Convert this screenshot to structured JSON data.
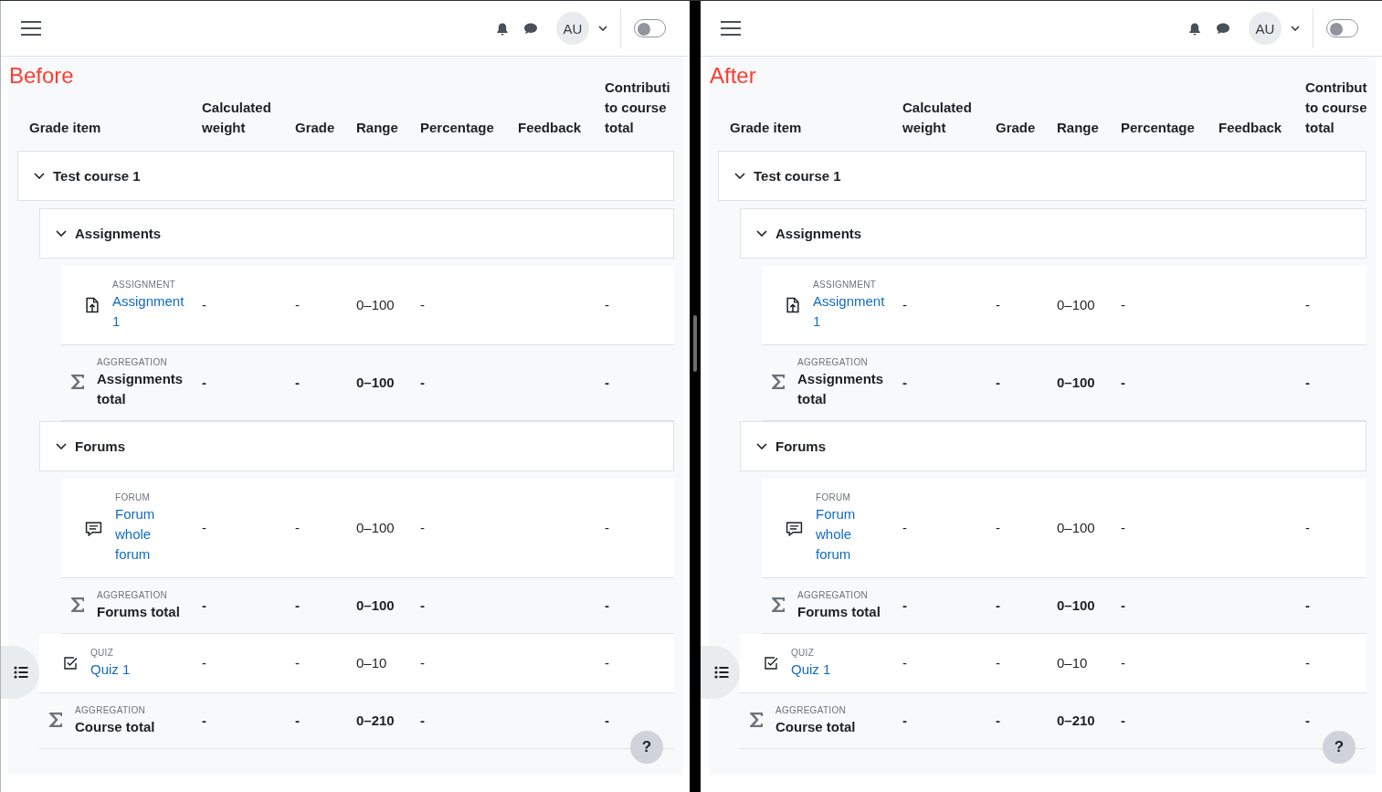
{
  "panels": [
    {
      "title": "Before",
      "navbar": {
        "avatar": "AU",
        "toggle_on": false
      },
      "columns": [
        "Grade item",
        "Calculated weight",
        "Grade",
        "Range",
        "Percentage",
        "Feedback",
        "Contributi to course total"
      ],
      "rows": [
        {
          "kind": "category",
          "name": "Test course 1",
          "expanded": true,
          "children": [
            {
              "kind": "category",
              "name": "Assignments",
              "expanded": true,
              "children": [
                {
                  "kind": "assignment",
                  "type": "ASSIGNMENT",
                  "name": "Assignment 1",
                  "values": {
                    "weight": "-",
                    "grade": "-",
                    "range": "0–100",
                    "percentage": "-",
                    "contribution": "-"
                  }
                },
                {
                  "kind": "aggregation",
                  "type": "AGGREGATION",
                  "name": "Assignments total",
                  "values": {
                    "weight": "-",
                    "grade": "-",
                    "range": "0–100",
                    "percentage": "-",
                    "contribution": "-"
                  }
                }
              ]
            },
            {
              "kind": "category",
              "name": "Forums",
              "expanded": true,
              "children": [
                {
                  "kind": "forum",
                  "type": "FORUM",
                  "name": "Forum whole forum",
                  "values": {
                    "weight": "-",
                    "grade": "-",
                    "range": "0–100",
                    "percentage": "-",
                    "contribution": "-"
                  }
                },
                {
                  "kind": "aggregation",
                  "type": "AGGREGATION",
                  "name": "Forums total",
                  "values": {
                    "weight": "-",
                    "grade": "-",
                    "range": "0–100",
                    "percentage": "-",
                    "contribution": "-"
                  }
                }
              ]
            },
            {
              "kind": "quiz",
              "type": "QUIZ",
              "name": "Quiz 1",
              "values": {
                "weight": "-",
                "grade": "-",
                "range": "0–10",
                "percentage": "-",
                "contribution": "-"
              }
            },
            {
              "kind": "aggregation",
              "type": "AGGREGATION",
              "name": "Course total",
              "values": {
                "weight": "-",
                "grade": "-",
                "range": "0–210",
                "percentage": "-",
                "contribution": "-"
              }
            }
          ]
        }
      ],
      "help": "?"
    },
    {
      "title": "After",
      "navbar": {
        "avatar": "AU",
        "toggle_on": false
      },
      "columns": [
        "Grade item",
        "Calculated weight",
        "Grade",
        "Range",
        "Percentage",
        "Feedback",
        "Contribut to course total"
      ],
      "rows": [
        {
          "kind": "category",
          "name": "Test course 1",
          "expanded": true,
          "children": [
            {
              "kind": "category",
              "name": "Assignments",
              "expanded": true,
              "children": [
                {
                  "kind": "assignment",
                  "type": "ASSIGNMENT",
                  "name": "Assignment 1",
                  "values": {
                    "weight": "-",
                    "grade": "-",
                    "range": "0–100",
                    "percentage": "-",
                    "contribution": "-"
                  }
                },
                {
                  "kind": "aggregation",
                  "type": "AGGREGATION",
                  "name": "Assignments total",
                  "values": {
                    "weight": "-",
                    "grade": "-",
                    "range": "0–100",
                    "percentage": "-",
                    "contribution": "-"
                  }
                }
              ]
            },
            {
              "kind": "category",
              "name": "Forums",
              "expanded": true,
              "children": [
                {
                  "kind": "forum",
                  "type": "FORUM",
                  "name": "Forum whole forum",
                  "values": {
                    "weight": "-",
                    "grade": "-",
                    "range": "0–100",
                    "percentage": "-",
                    "contribution": "-"
                  }
                },
                {
                  "kind": "aggregation",
                  "type": "AGGREGATION",
                  "name": "Forums total",
                  "values": {
                    "weight": "-",
                    "grade": "-",
                    "range": "0–100",
                    "percentage": "-",
                    "contribution": "-"
                  }
                }
              ]
            },
            {
              "kind": "quiz",
              "type": "QUIZ",
              "name": "Quiz 1",
              "values": {
                "weight": "-",
                "grade": "-",
                "range": "0–10",
                "percentage": "-",
                "contribution": "-"
              }
            },
            {
              "kind": "aggregation",
              "type": "AGGREGATION",
              "name": "Course total",
              "values": {
                "weight": "-",
                "grade": "-",
                "range": "0–210",
                "percentage": "-",
                "contribution": "-"
              }
            }
          ]
        }
      ],
      "help": "?"
    }
  ]
}
